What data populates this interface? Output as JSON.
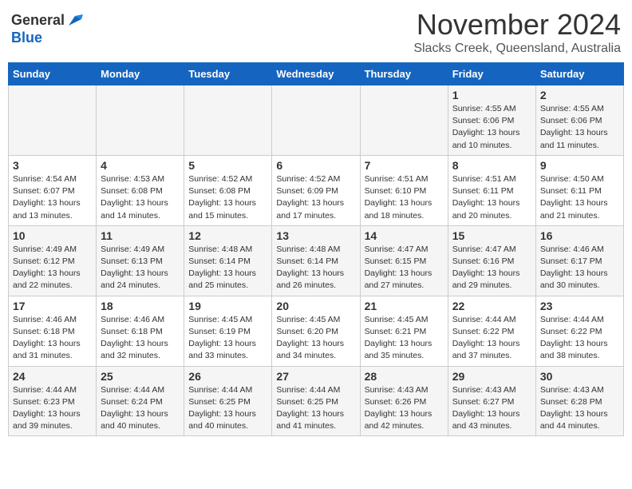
{
  "header": {
    "logo_line1": "General",
    "logo_line2": "Blue",
    "month": "November 2024",
    "location": "Slacks Creek, Queensland, Australia"
  },
  "days_of_week": [
    "Sunday",
    "Monday",
    "Tuesday",
    "Wednesday",
    "Thursday",
    "Friday",
    "Saturday"
  ],
  "weeks": [
    [
      {
        "day": "",
        "info": ""
      },
      {
        "day": "",
        "info": ""
      },
      {
        "day": "",
        "info": ""
      },
      {
        "day": "",
        "info": ""
      },
      {
        "day": "",
        "info": ""
      },
      {
        "day": "1",
        "info": "Sunrise: 4:55 AM\nSunset: 6:06 PM\nDaylight: 13 hours and 10 minutes."
      },
      {
        "day": "2",
        "info": "Sunrise: 4:55 AM\nSunset: 6:06 PM\nDaylight: 13 hours and 11 minutes."
      }
    ],
    [
      {
        "day": "3",
        "info": "Sunrise: 4:54 AM\nSunset: 6:07 PM\nDaylight: 13 hours and 13 minutes."
      },
      {
        "day": "4",
        "info": "Sunrise: 4:53 AM\nSunset: 6:08 PM\nDaylight: 13 hours and 14 minutes."
      },
      {
        "day": "5",
        "info": "Sunrise: 4:52 AM\nSunset: 6:08 PM\nDaylight: 13 hours and 15 minutes."
      },
      {
        "day": "6",
        "info": "Sunrise: 4:52 AM\nSunset: 6:09 PM\nDaylight: 13 hours and 17 minutes."
      },
      {
        "day": "7",
        "info": "Sunrise: 4:51 AM\nSunset: 6:10 PM\nDaylight: 13 hours and 18 minutes."
      },
      {
        "day": "8",
        "info": "Sunrise: 4:51 AM\nSunset: 6:11 PM\nDaylight: 13 hours and 20 minutes."
      },
      {
        "day": "9",
        "info": "Sunrise: 4:50 AM\nSunset: 6:11 PM\nDaylight: 13 hours and 21 minutes."
      }
    ],
    [
      {
        "day": "10",
        "info": "Sunrise: 4:49 AM\nSunset: 6:12 PM\nDaylight: 13 hours and 22 minutes."
      },
      {
        "day": "11",
        "info": "Sunrise: 4:49 AM\nSunset: 6:13 PM\nDaylight: 13 hours and 24 minutes."
      },
      {
        "day": "12",
        "info": "Sunrise: 4:48 AM\nSunset: 6:14 PM\nDaylight: 13 hours and 25 minutes."
      },
      {
        "day": "13",
        "info": "Sunrise: 4:48 AM\nSunset: 6:14 PM\nDaylight: 13 hours and 26 minutes."
      },
      {
        "day": "14",
        "info": "Sunrise: 4:47 AM\nSunset: 6:15 PM\nDaylight: 13 hours and 27 minutes."
      },
      {
        "day": "15",
        "info": "Sunrise: 4:47 AM\nSunset: 6:16 PM\nDaylight: 13 hours and 29 minutes."
      },
      {
        "day": "16",
        "info": "Sunrise: 4:46 AM\nSunset: 6:17 PM\nDaylight: 13 hours and 30 minutes."
      }
    ],
    [
      {
        "day": "17",
        "info": "Sunrise: 4:46 AM\nSunset: 6:18 PM\nDaylight: 13 hours and 31 minutes."
      },
      {
        "day": "18",
        "info": "Sunrise: 4:46 AM\nSunset: 6:18 PM\nDaylight: 13 hours and 32 minutes."
      },
      {
        "day": "19",
        "info": "Sunrise: 4:45 AM\nSunset: 6:19 PM\nDaylight: 13 hours and 33 minutes."
      },
      {
        "day": "20",
        "info": "Sunrise: 4:45 AM\nSunset: 6:20 PM\nDaylight: 13 hours and 34 minutes."
      },
      {
        "day": "21",
        "info": "Sunrise: 4:45 AM\nSunset: 6:21 PM\nDaylight: 13 hours and 35 minutes."
      },
      {
        "day": "22",
        "info": "Sunrise: 4:44 AM\nSunset: 6:22 PM\nDaylight: 13 hours and 37 minutes."
      },
      {
        "day": "23",
        "info": "Sunrise: 4:44 AM\nSunset: 6:22 PM\nDaylight: 13 hours and 38 minutes."
      }
    ],
    [
      {
        "day": "24",
        "info": "Sunrise: 4:44 AM\nSunset: 6:23 PM\nDaylight: 13 hours and 39 minutes."
      },
      {
        "day": "25",
        "info": "Sunrise: 4:44 AM\nSunset: 6:24 PM\nDaylight: 13 hours and 40 minutes."
      },
      {
        "day": "26",
        "info": "Sunrise: 4:44 AM\nSunset: 6:25 PM\nDaylight: 13 hours and 40 minutes."
      },
      {
        "day": "27",
        "info": "Sunrise: 4:44 AM\nSunset: 6:25 PM\nDaylight: 13 hours and 41 minutes."
      },
      {
        "day": "28",
        "info": "Sunrise: 4:43 AM\nSunset: 6:26 PM\nDaylight: 13 hours and 42 minutes."
      },
      {
        "day": "29",
        "info": "Sunrise: 4:43 AM\nSunset: 6:27 PM\nDaylight: 13 hours and 43 minutes."
      },
      {
        "day": "30",
        "info": "Sunrise: 4:43 AM\nSunset: 6:28 PM\nDaylight: 13 hours and 44 minutes."
      }
    ]
  ]
}
